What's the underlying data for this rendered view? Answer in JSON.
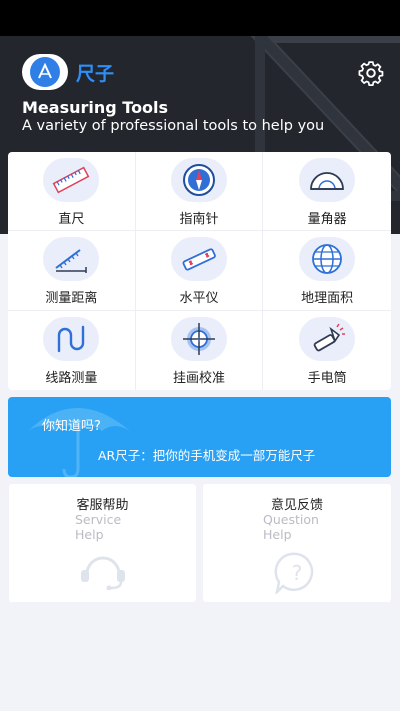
{
  "app": {
    "brand": "尺子",
    "title": "Measuring Tools",
    "subtitle": "A variety of professional tools to help you"
  },
  "icons": {
    "logo": "ruler-logo-icon",
    "settings": "gear-icon"
  },
  "colors": {
    "accent": "#2f8ff7",
    "header_bg": "#23262d",
    "banner_bg": "#28a1f4",
    "page_bg": "#f1f3f9",
    "icon_bg": "#e9eefa"
  },
  "tools": [
    {
      "label": "直尺",
      "icon": "ruler-icon"
    },
    {
      "label": "指南针",
      "icon": "compass-icon"
    },
    {
      "label": "量角器",
      "icon": "protractor-icon"
    },
    {
      "label": "测量距离",
      "icon": "distance-measure-icon"
    },
    {
      "label": "水平仪",
      "icon": "level-icon"
    },
    {
      "label": "地理面积",
      "icon": "globe-icon"
    },
    {
      "label": "线路测量",
      "icon": "route-icon"
    },
    {
      "label": "挂画校准",
      "icon": "target-icon"
    },
    {
      "label": "手电筒",
      "icon": "flashlight-icon"
    }
  ],
  "banner": {
    "question": "你知道吗?",
    "text": "AR尺子：把你的手机变成一部万能尺子",
    "icon": "umbrella-icon"
  },
  "cards": {
    "service": {
      "title": "客服帮助",
      "en_line1": "Service",
      "en_line2": "Help",
      "icon": "headset-icon"
    },
    "feedback": {
      "title": "意见反馈",
      "en_line1": "Question",
      "en_line2": "Help",
      "icon": "question-icon"
    }
  }
}
